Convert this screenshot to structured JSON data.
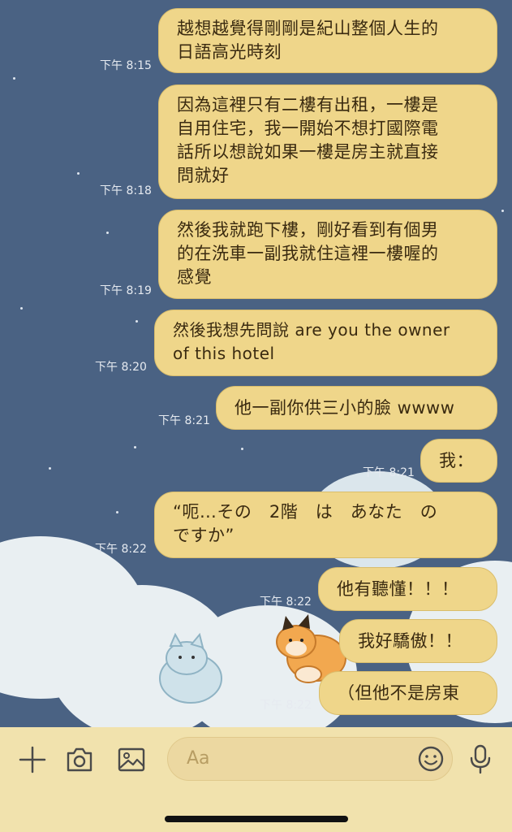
{
  "messages": [
    {
      "text": "越想越覺得剛剛是紀山整個人生的\n日語高光時刻",
      "time": "下午 8:15"
    },
    {
      "text": "因為這裡只有二樓有出租，一樓是\n自用住宅，我一開始不想打國際電\n話所以想說如果一樓是房主就直接\n問就好",
      "time": "下午 8:18"
    },
    {
      "text": "然後我就跑下樓，剛好看到有個男\n的在洗車一副我就住這裡一樓喔的\n感覺",
      "time": "下午 8:19"
    },
    {
      "text": "然後我想先問說 are you the owner\nof this hotel",
      "time": "下午 8:20"
    },
    {
      "text": "他一副你供三小的臉 wwww",
      "time": "下午 8:21"
    },
    {
      "text": "我：",
      "time": "下午 8:21"
    },
    {
      "text": "“呃…その　2階　は　あなた　の\nですか”",
      "time": "下午 8:22"
    },
    {
      "text": "他有聽懂！！！",
      "time": "下午 8:22"
    },
    {
      "text": "我好驕傲！！",
      "time": ""
    },
    {
      "text": "（但他不是房東",
      "time": "下午 8:22"
    }
  ],
  "composer": {
    "placeholder": "Aa",
    "icons": [
      "plus-icon",
      "camera-icon",
      "image-icon",
      "emoji-icon",
      "microphone-icon"
    ]
  },
  "colors": {
    "background": "#4a6283",
    "bubble": "#efd68a",
    "composer": "#f1e2ad"
  }
}
